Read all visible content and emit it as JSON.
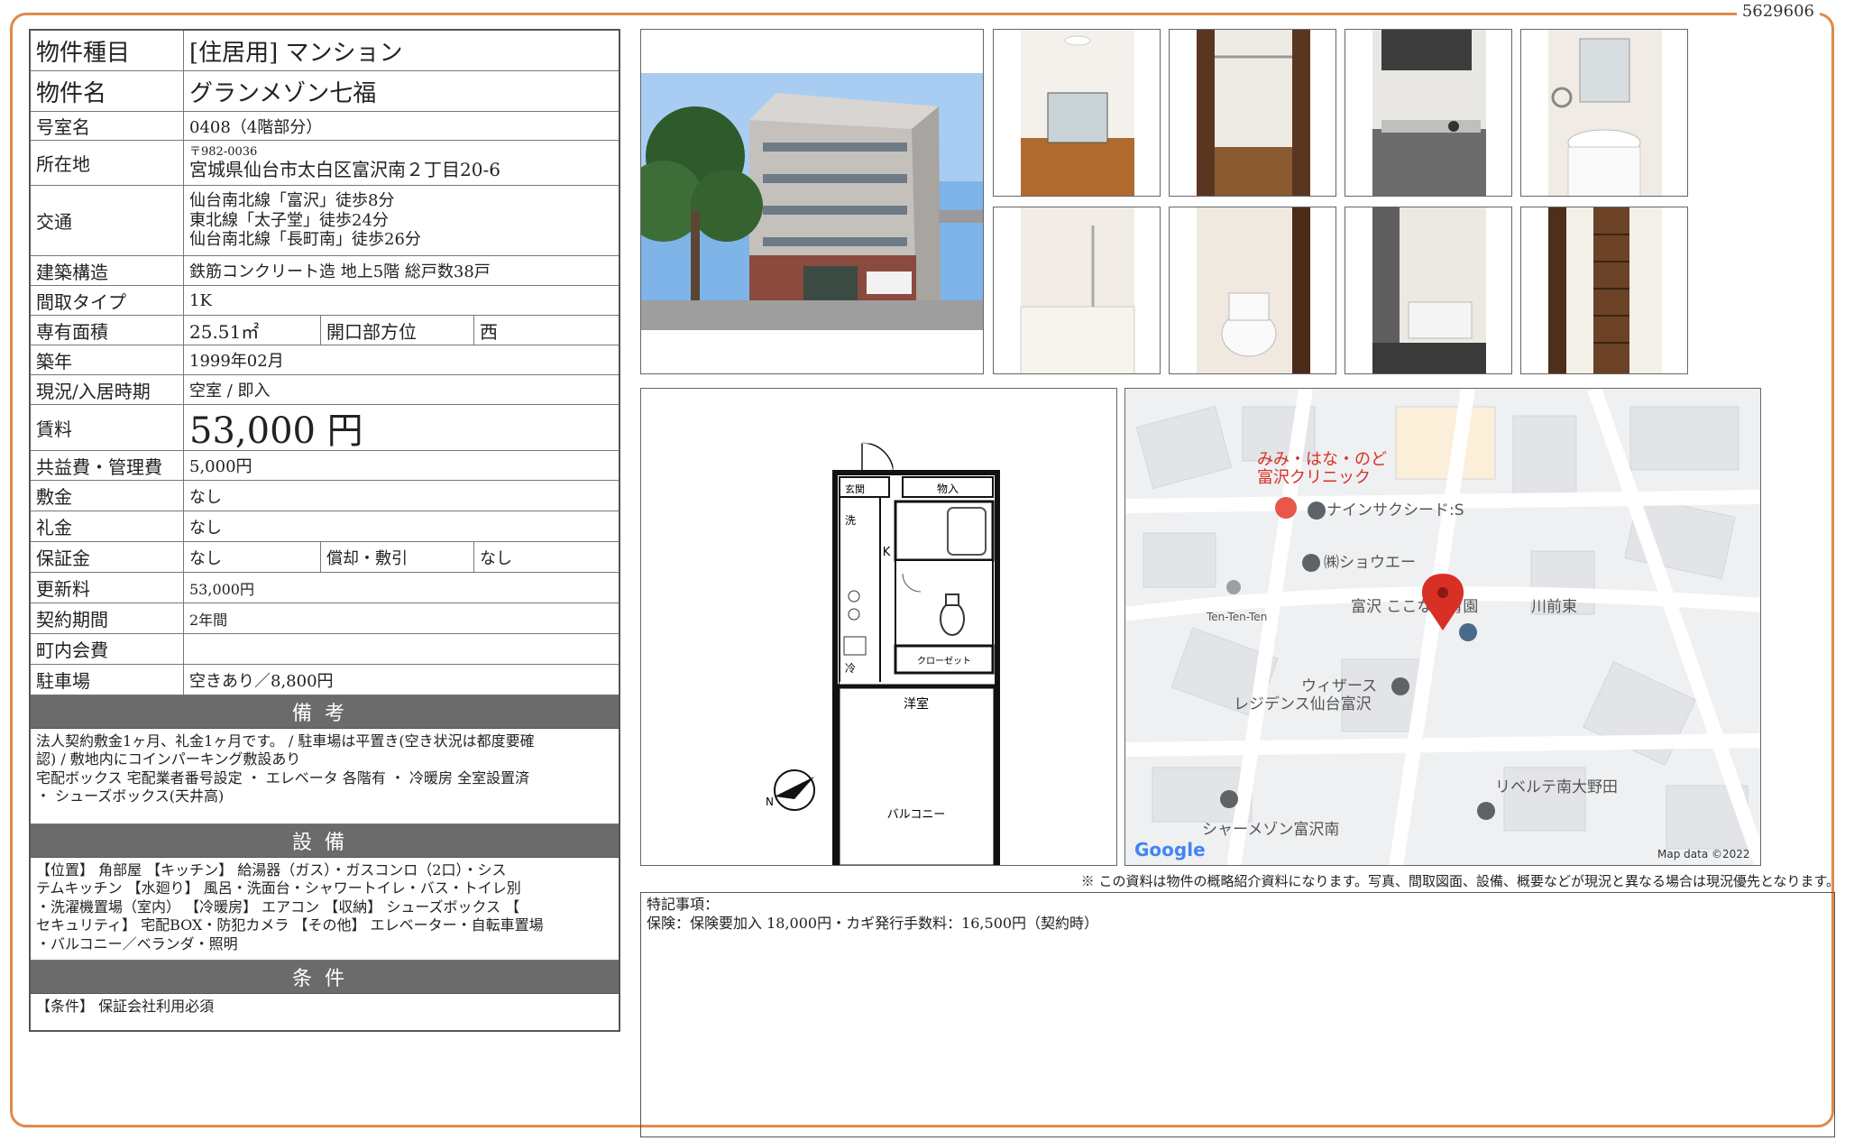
{
  "doc_id": "5629606",
  "property": {
    "type_label": "物件種目",
    "type_value": "[住居用] マンション",
    "name_label": "物件名",
    "name_value": "グランメゾン七福",
    "room_label": "号室名",
    "room_value": "0408（4階部分）",
    "address_label": "所在地",
    "postal": "〒982-0036",
    "address": "宮城県仙台市太白区富沢南２丁目20-6",
    "transport_label": "交通",
    "transport": [
      "仙台南北線「富沢」徒歩8分",
      "東北線「太子堂」徒歩24分",
      "仙台南北線「長町南」徒歩26分"
    ],
    "structure_label": "建築構造",
    "structure_value": "鉄筋コンクリート造 地上5階 総戸数38戸",
    "layout_label": "間取タイプ",
    "layout_value": "1K",
    "area_label": "専有面積",
    "area_value": "25.51㎡",
    "direction_label": "開口部方位",
    "direction_value": "西",
    "built_label": "築年",
    "built_value": "1999年02月",
    "status_label": "現況/入居時期",
    "status_value": "空室 / 即入",
    "rent_label": "賃料",
    "rent_value": "53,000 円",
    "fee_label": "共益費・管理費",
    "fee_value": "5,000円",
    "deposit_label": "敷金",
    "deposit_value": "なし",
    "key_money_label": "礼金",
    "key_money_value": "なし",
    "guarantee_label": "保証金",
    "guarantee_value": "なし",
    "amort_label": "償却・敷引",
    "amort_value": "なし",
    "renewal_label": "更新料",
    "renewal_value": "53,000円",
    "contract_label": "契約期間",
    "contract_value": "2年間",
    "town_label": "町内会費",
    "town_value": "",
    "parking_label": "駐車場",
    "parking_value": "空きあり／8,800円"
  },
  "remarks": {
    "heading": "備考",
    "lines": [
      "法人契約敷金1ヶ月、礼金1ヶ月です。 / 駐車場は平置き(空き状況は都度要確",
      "認) / 敷地内にコインパーキング敷設あり",
      "宅配ボックス 宅配業者番号設定 ・ エレベータ 各階有 ・ 冷暖房 全室設置済",
      "・ シューズボックス(天井高)"
    ]
  },
  "equipment": {
    "heading": "設備",
    "lines": [
      "【位置】 角部屋 【キッチン】 給湯器（ガス）・ガスコンロ（2口）・シス",
      "テムキッチン 【水廻り】 風呂・洗面台・シャワートイレ・バス・トイレ別",
      "・洗濯機置場（室内） 【冷暖房】 エアコン 【収納】 シューズボックス 【",
      "セキュリティ】 宅配BOX・防犯カメラ 【その他】 エレベーター・自転車置場",
      "・バルコニー／ベランダ・照明"
    ]
  },
  "conditions": {
    "heading": "条件",
    "lines": [
      "【条件】 保証会社利用必須"
    ]
  },
  "floorplan": {
    "entrance": "玄関",
    "storage": "物入",
    "wash": "洗",
    "fridge": "冷",
    "kitchen": "K",
    "closet": "クローゼット",
    "room": "洋室",
    "balcony": "バルコニー",
    "north": "N"
  },
  "map": {
    "labels": [
      "みみ・はな・のど",
      "富沢クリニック",
      "ナインサクシード:S",
      "㈱ショウエー",
      "Ten-Ten-Ten",
      "富沢 ここな保育園",
      "川前東",
      "ウィザース",
      "レジデンス仙台富沢",
      "リベルテ南大野田",
      "シャーメゾン富沢南"
    ],
    "brand": "Google",
    "credit": "Map data ©2022",
    "pin_color": "#d93025"
  },
  "disclaimer": "※ この資料は物件の概略紹介資料になります。写真、間取図面、設備、概要などが現況と異なる場合は現況優先となります。",
  "special": {
    "heading": "特記事項：",
    "text": "保険：保険要加入 18,000円・カギ発行手数料：16,500円（契約時）"
  },
  "colors": {
    "frame": "#e08a4c",
    "section": "#6b6b6b"
  }
}
